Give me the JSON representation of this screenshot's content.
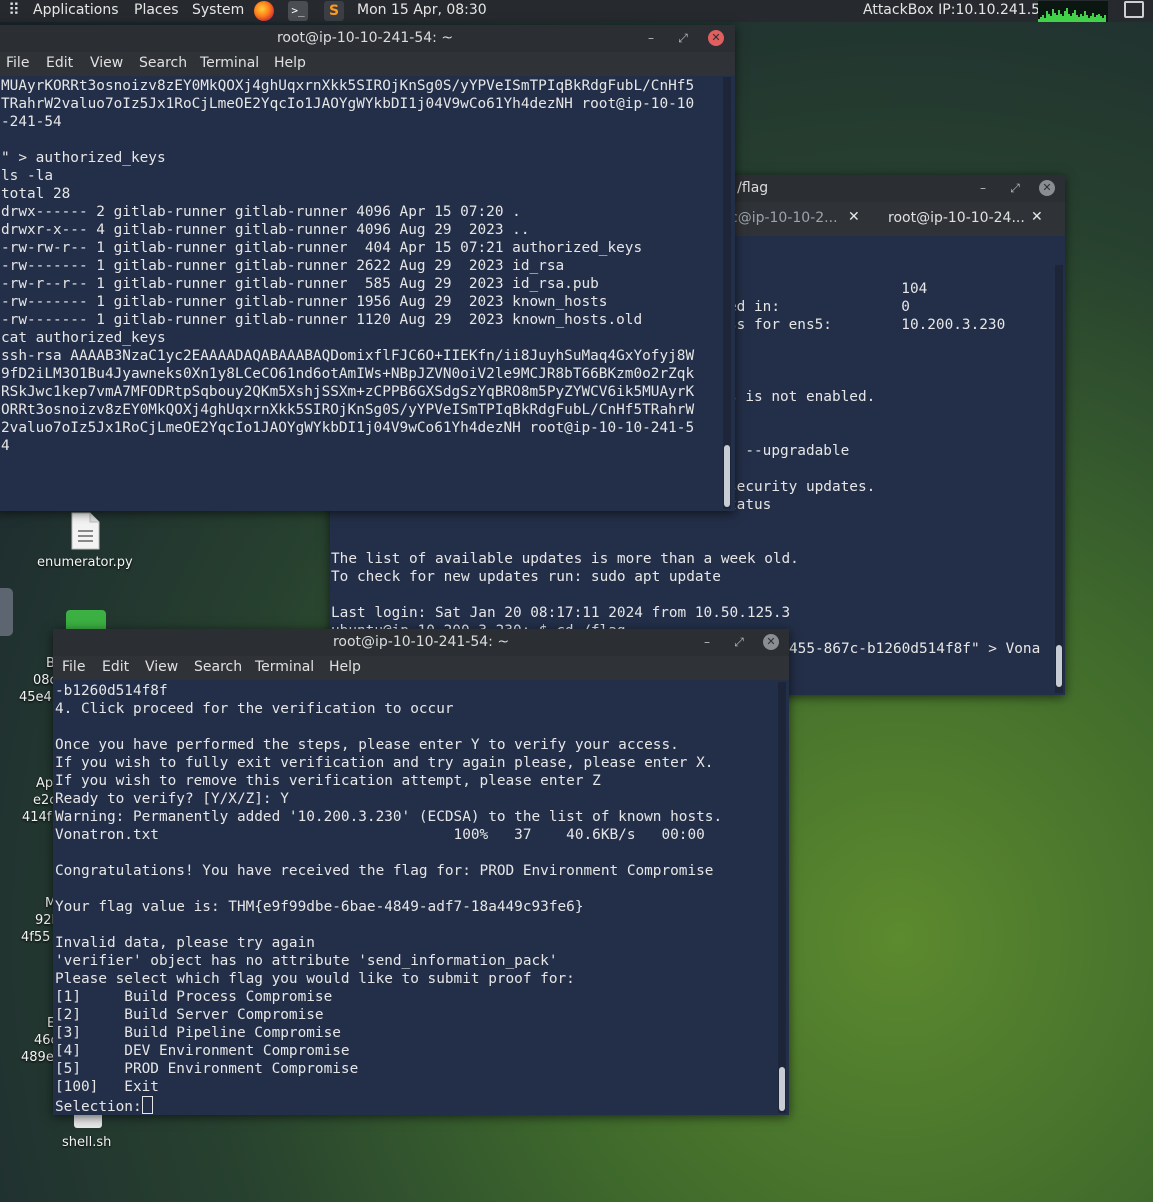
{
  "topbar": {
    "menus": [
      "Applications",
      "Places",
      "System"
    ],
    "clock": "Mon 15 Apr, 08:30",
    "attackbox_ip": "AttackBox IP:10.10.241.54",
    "cpu_levels": [
      0.15,
      0.25,
      0.35,
      0.2,
      0.5,
      0.4,
      0.3,
      0.6,
      0.45,
      0.35,
      0.55,
      0.4,
      0.3,
      0.5,
      0.65,
      0.4,
      0.3,
      0.45,
      0.55,
      0.35,
      0.25,
      0.4,
      0.3,
      0.5,
      0.35,
      0.2,
      0.3,
      0.45,
      0.25,
      0.35,
      0.4,
      0.3,
      0.2,
      0.35
    ]
  },
  "desktop": {
    "enumerator_label": "enumerator.py",
    "shell_label": "shell.sh",
    "partial_labels": [
      [
        "B",
        "08c",
        "45e4"
      ],
      [
        "Ap",
        "e2c",
        "414f"
      ],
      [
        "M",
        "92b",
        "4f55"
      ],
      [
        "E",
        "46c",
        "489e"
      ]
    ]
  },
  "menu_labels": [
    "File",
    "Edit",
    "View",
    "Search",
    "Terminal",
    "Help"
  ],
  "win_top": {
    "title": "root@ip-10-10-241-54: ~",
    "lines": [
      "MUAyrKORRt3osnoizv8zEY0MkQOXj4ghUqxrnXkk5SIROjKnSg0S/yYPVeISmTPIqBkRdgFubL/CnHf5",
      "TRahrW2valuo7oIz5Jx1RoCjLmeOE2YqcIo1JAOYgWYkbDI1j04V9wCo61Yh4dezNH root@ip-10-10",
      "-241-54",
      "",
      "\" > authorized_keys",
      "ls -la",
      "total 28",
      "drwx------ 2 gitlab-runner gitlab-runner 4096 Apr 15 07:20 .",
      "drwxr-x--- 4 gitlab-runner gitlab-runner 4096 Aug 29  2023 ..",
      "-rw-rw-r-- 1 gitlab-runner gitlab-runner  404 Apr 15 07:21 authorized_keys",
      "-rw------- 1 gitlab-runner gitlab-runner 2622 Aug 29  2023 id_rsa",
      "-rw-r--r-- 1 gitlab-runner gitlab-runner  585 Aug 29  2023 id_rsa.pub",
      "-rw------- 1 gitlab-runner gitlab-runner 1956 Aug 29  2023 known_hosts",
      "-rw------- 1 gitlab-runner gitlab-runner 1120 Aug 29  2023 known_hosts.old",
      "cat authorized_keys",
      "ssh-rsa AAAAB3NzaC1yc2EAAAADAQABAAABAQDomixflFJC6O+IIEKfn/ii8JuyhSuMaq4GxYofyj8W",
      "9fD2iLM3O1Bu4Jyawneks0Xn1y8LCeCO61nd6otAmIWs+NBpJZVN0oiV2le9MCJR8bT66BKzm0o2rZqk",
      "RSkJwc1kep7vmA7MFODRtpSqbouy2QKm5XshjSSXm+zCPPB6GXSdgSzYqBRO8m5PyZYWCV6ik5MUAyrK",
      "ORRt3osnoizv8zEY0MkQOXj4ghUqxrnXkk5SIROjKnSg0S/yYPVeISmTPIqBkRdgFubL/CnHf5TRahrW",
      "2valuo7oIz5Jx1RoCjLmeOE2YqcIo1JAOYgWYkbDI1j04V9wCo61Yh4dezNH root@ip-10-10-241-5",
      "4"
    ]
  },
  "win_right": {
    "title": ": /flag",
    "tabs": [
      "c@ip-10-10-2...",
      "root@ip-10-10-24..."
    ],
    "lines_upper": [
      "                    104",
      "ed in:              0",
      "ss for ens5:        10.200.3.230",
      "",
      "",
      "",
      "s is not enabled.",
      "",
      "",
      ": --upgradable",
      "",
      "security updates.",
      "tatus"
    ],
    "lines_lower": [
      "",
      "",
      "The list of available updates is more than a week old.",
      "To check for new updates run: sudo apt update",
      "",
      "Last login: Sat Jan 20 08:17:11 2024 from 10.50.125.3",
      "ubuntu@ip-10-200-3-230:~$ cd /flag"
    ],
    "tail_line": "455-867c-b1260d514f8f\" > Vona"
  },
  "win_bottom": {
    "title": "root@ip-10-10-241-54: ~",
    "lines": [
      "-b1260d514f8f",
      "4. Click proceed for the verification to occur",
      "",
      "Once you have performed the steps, please enter Y to verify your access.",
      "If you wish to fully exit verification and try again please, please enter X.",
      "If you wish to remove this verification attempt, please enter Z",
      "Ready to verify? [Y/X/Z]: Y",
      "Warning: Permanently added '10.200.3.230' (ECDSA) to the list of known hosts.",
      "Vonatron.txt                                  100%   37    40.6KB/s   00:00",
      "",
      "Congratulations! You have received the flag for: PROD Environment Compromise",
      "",
      "Your flag value is: THM{e9f99dbe-6bae-4849-adf7-18a449c93fe6}",
      "",
      "Invalid data, please try again",
      "'verifier' object has no attribute 'send_information_pack'",
      "Please select which flag you would like to submit proof for:",
      "[1]     Build Process Compromise",
      "[2]     Build Server Compromise",
      "[3]     Build Pipeline Compromise",
      "[4]     DEV Environment Compromise",
      "[5]     PROD Environment Compromise",
      "[100]   Exit"
    ],
    "prompt": "Selection:"
  },
  "colors": {
    "terminal_bg": "#232f48",
    "titlebar_bg": "#2b2e33",
    "close_red": "#e05f5f",
    "panel_bg": "#26292e"
  }
}
